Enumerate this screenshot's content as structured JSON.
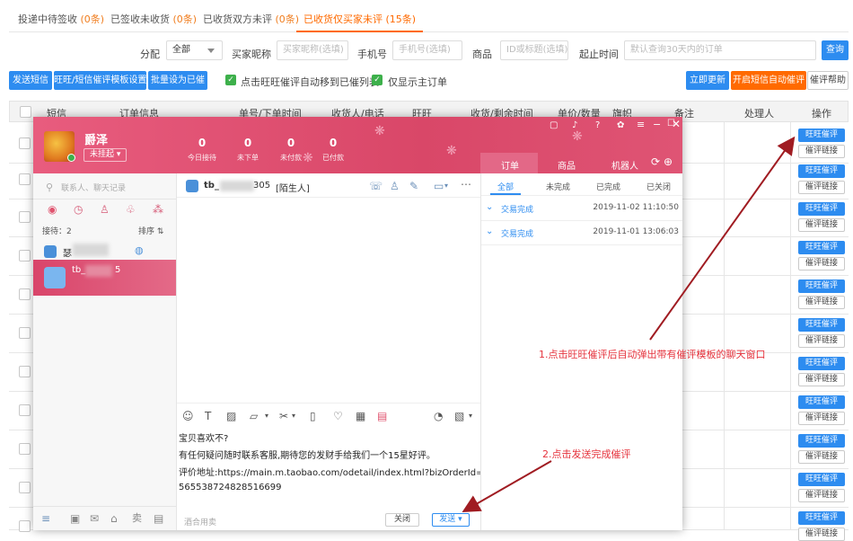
{
  "tabs": [
    {
      "label": "投递中待签收",
      "count": "(0条)"
    },
    {
      "label": "已签收未收货",
      "count": "(0条)"
    },
    {
      "label": "已收货双方未评",
      "count": "(0条)"
    },
    {
      "label": "已收货仅买家未评",
      "count": "(15条)"
    }
  ],
  "filters": {
    "distribute_label": "分配",
    "distribute_value": "全部",
    "nick_label": "买家昵称",
    "nick_placeholder": "买家昵称(选填)",
    "phone_label": "手机号",
    "phone_placeholder": "手机号(选填)",
    "product_label": "商品",
    "product_placeholder": "ID或标题(选填)",
    "time_label": "起止时间",
    "time_placeholder": "默认查询30天内的订单",
    "query_button": "查询"
  },
  "toolbar": {
    "send_sms": "发送短信",
    "template_settings": "旺旺/短信催评模板设置",
    "batch_mark": "批量设为已催",
    "auto_move_label": "点击旺旺催评自动移到已催列表",
    "main_order_label": "仅显示主订单",
    "update_now": "立即更新",
    "auto_sms": "开启短信自动催评",
    "help": "催评帮助"
  },
  "table": {
    "headers": [
      "短信",
      "订单信息",
      "单号/下单时间",
      "收货人/电话",
      "旺旺",
      "收货/剩余时间",
      "单价/数量",
      "旗帜",
      "备注",
      "处理人",
      "操作"
    ],
    "row_action_primary": "旺旺催评",
    "row_action_secondary": "催评链接"
  },
  "chat": {
    "user_name": "爵泽",
    "status": "未挂起",
    "stats": [
      {
        "value": "0",
        "label": "今日接待"
      },
      {
        "value": "0",
        "label": "未下单"
      },
      {
        "value": "0",
        "label": "未付款"
      },
      {
        "value": "0",
        "label": "已付款"
      }
    ],
    "right_tabs": [
      "订单",
      "商品",
      "机器人"
    ],
    "search_placeholder": "联系人、聊天记录",
    "reception_label": "接待：2",
    "sort_label": "排序",
    "contact1_prefix": "瑟",
    "contact2_name": "tb_",
    "contact2_suffix": "5",
    "chat_title": "tb_",
    "chat_title_suffix": "305",
    "chat_title_tag": "[陌生人]",
    "message_lines": [
      "宝贝喜欢不?",
      "有任何疑问随时联系客服,期待您的发财手给我们一个15星好评。",
      "评价地址:https://main.m.taobao.com/odetail/index.html?bizOrderId=",
      "565538724828516699"
    ],
    "quick_reply": "酒合用卖",
    "close_button": "关闭",
    "send_button": "发送",
    "order_subtabs": [
      "全部",
      "未完成",
      "已完成",
      "已关闭"
    ],
    "orders": [
      {
        "status": "交易完成",
        "date": "2019-11-02 11:10:50"
      },
      {
        "status": "交易完成",
        "date": "2019-11-01 13:06:03"
      }
    ]
  },
  "annotations": {
    "step1": "1.点击旺旺催评后自动弹出带有催评模板的聊天窗口",
    "step2": "2.点击发送完成催评"
  },
  "colors": {
    "accent_orange": "#ff6a00",
    "primary_blue": "#2d8cf0",
    "chat_header": "#d94768",
    "annotation_red": "#e5323c",
    "check_green": "#3db04b"
  }
}
